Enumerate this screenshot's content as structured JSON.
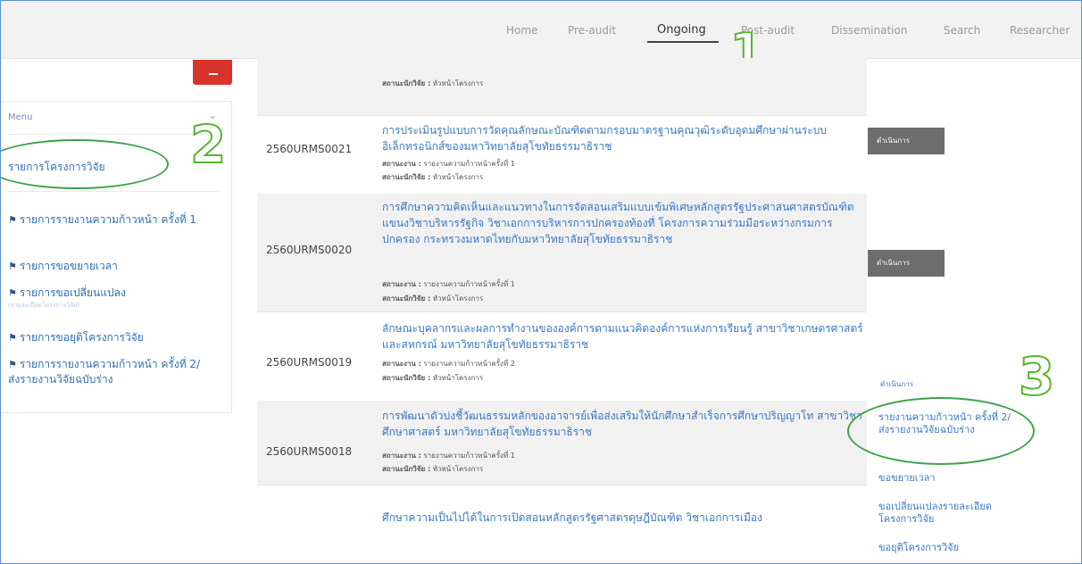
{
  "nav": {
    "items": [
      "Home",
      "Pre-audit",
      "Ongoing",
      "Post-audit",
      "Dissemination",
      "Search",
      "Researcher"
    ],
    "active": "Ongoing"
  },
  "annotations": [
    "1",
    "2",
    "3"
  ],
  "sidebar": {
    "menu_label": "Menu",
    "toggle": "⌄",
    "primary_item": "รายการโครงการวิจัย",
    "links": [
      "รายการรายงานความก้าวหน้า ครั้งที่ 1",
      "รายการขอขยายเวลา",
      "รายการขอเปลี่ยนแปลง",
      "รายการขอยุติโครงการวิจัย",
      "รายการรายงานความก้าวหน้า ครั้งที่ 2/ส่งรายงานวิจัยฉบับร่าง"
    ],
    "links_sub": "(รายละเอียดโครงการวิจัย)"
  },
  "rows": [
    {
      "code": "",
      "title": "",
      "meta": [
        {
          "label": "สถานะนักวิจัย :",
          "value": "หัวหน้าโครงการ"
        }
      ],
      "button": ""
    },
    {
      "code": "2560URMS0021",
      "title": "การประเมินรูปแบบการวัดคุณลักษณะบัณฑิตตามกรอบมาตรฐานคุณวุฒิระดับอุดมศึกษาผ่านระบบอิเล็กทรอนิกส์ของมหาวิทยาลัยสุโขทัยธรรมาธิราช",
      "meta": [
        {
          "label": "สถานะงาน :",
          "value": "รายงานความก้าวหน้าครั้งที่ 1"
        },
        {
          "label": "สถานะนักวิจัย :",
          "value": "หัวหน้าโครงการ"
        }
      ],
      "button": "ดำเนินการ"
    },
    {
      "code": "2560URMS0020",
      "title": "การศึกษาความคิดเห็นและแนวทางในการจัดสอนเสริมแบบเข้มพิเศษหลักสูตรรัฐประศาสนศาสตรบัณฑิต แขนงวิชาบริหารรัฐกิจ วิชาเอกการบริหารการปกครองท้องที่ โครงการความร่วมมือระหว่างกรมการปกครอง กระทรวงมหาดไทยกับมหาวิทยาลัยสุโขทัยธรรมาธิราช",
      "meta": [
        {
          "label": "สถานะงาน :",
          "value": "รายงานความก้าวหน้าครั้งที่ 1"
        },
        {
          "label": "สถานะนักวิจัย :",
          "value": "หัวหน้าโครงการ"
        }
      ],
      "button": "ดำเนินการ"
    },
    {
      "code": "2560URMS0019",
      "title": "ลักษณะบุคลากรและผลการทำงานขององค์การตามแนวคิดองค์การแห่งการเรียนรู้ สาขาวิชาเกษตรศาสตร์และสหกรณ์ มหาวิทยาลัยสุโขทัยธรรมาธิราช",
      "meta": [
        {
          "label": "สถานะงาน :",
          "value": "รายงานความก้าวหน้าครั้งที่ 2"
        },
        {
          "label": "สถานะนักวิจัย :",
          "value": "หัวหน้าโครงการ"
        }
      ],
      "button": ""
    },
    {
      "code": "2560URMS0018",
      "title": "การพัฒนาตัวบ่งชี้วัฒนธรรมหลักของอาจารย์เพื่อส่งเสริมให้นักศึกษาสำเร็จการศึกษาปริญญาโท สาขาวิชาศึกษาศาสตร์ มหาวิทยาลัยสุโขทัยธรรมาธิราช",
      "meta": [
        {
          "label": "สถานะงาน :",
          "value": "รายงานความก้าวหน้าครั้งที่ 1"
        },
        {
          "label": "สถานะนักวิจัย :",
          "value": "หัวหน้าโครงการ"
        }
      ],
      "button": ""
    },
    {
      "code": "",
      "title": "ศึกษาความเป็นไปได้ในการเปิดสอนหลักสูตรรัฐศาสตรดุษฎีบัณฑิต วิชาเอกการเมือง",
      "meta": [],
      "button": ""
    }
  ],
  "dropdown": {
    "header": "ดำเนินการ",
    "items": [
      "รายงานความก้าวหน้า ครั้งที่ 2/ส่งรายงานวิจัยฉบับร่าง",
      "ขอขยายเวลา",
      "ขอเปลี่ยนแปลงรายละเอียดโครงการวิจัย",
      "ขอยุติโครงการวิจัย"
    ]
  },
  "colors": {
    "accent_blue": "#3a78c2",
    "annotation_green": "#3ba34a",
    "button_gray": "#6d6d6d",
    "alert_red": "#d6342a"
  }
}
